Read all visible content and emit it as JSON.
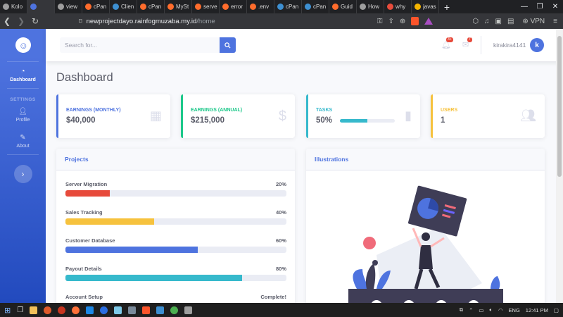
{
  "browser": {
    "tabs": [
      {
        "label": "Kolo",
        "color": "#9e9e9e"
      },
      {
        "label": "",
        "color": "#4e73df",
        "active": true
      },
      {
        "label": "view",
        "color": "#9e9e9e"
      },
      {
        "label": "cPan",
        "color": "#ff6c2c"
      },
      {
        "label": "Clien",
        "color": "#3d8fd1"
      },
      {
        "label": "cPan",
        "color": "#ff6c2c"
      },
      {
        "label": "MySt",
        "color": "#ff6c2c"
      },
      {
        "label": "serve",
        "color": "#ff6c2c"
      },
      {
        "label": "error",
        "color": "#ff6c2c"
      },
      {
        "label": ".env",
        "color": "#ff6c2c"
      },
      {
        "label": "cPan",
        "color": "#3d8fd1"
      },
      {
        "label": "cPan",
        "color": "#3d8fd1"
      },
      {
        "label": "Guid",
        "color": "#ff6c2c"
      },
      {
        "label": "How",
        "color": "#9e9e9e"
      },
      {
        "label": "why",
        "color": "#e74c3c"
      },
      {
        "label": "javas",
        "color": "#f4b400"
      }
    ],
    "url_host": "newprojectdayo.rainfogmuzaba.my.id",
    "url_path": "/home",
    "vpn_label": "VPN"
  },
  "sidebar": {
    "dashboard_label": "Dashboard",
    "heading": "SETTINGS",
    "profile_label": "Profile",
    "about_label": "About"
  },
  "topbar": {
    "search_placeholder": "Search for...",
    "alerts_badge": "3+",
    "messages_badge": "7",
    "username": "kirakira4141",
    "avatar_letter": "k"
  },
  "page_title": "Dashboard",
  "stats": [
    {
      "label": "EARNINGS (MONTHLY)",
      "value": "$40,000",
      "color": "#4e73df",
      "icon": "calendar-icon"
    },
    {
      "label": "EARNINGS (ANNUAL)",
      "value": "$215,000",
      "color": "#1cc88a",
      "icon": "dollar-icon"
    },
    {
      "label": "TASKS",
      "value": "50%",
      "progress": 50,
      "color": "#36b9cc",
      "icon": "clipboard-icon"
    },
    {
      "label": "USERS",
      "value": "1",
      "color": "#f6c23e",
      "icon": "users-icon"
    }
  ],
  "projects": {
    "title": "Projects",
    "items": [
      {
        "name": "Server Migration",
        "value_text": "20%",
        "percent": 20,
        "color": "#e74a3b"
      },
      {
        "name": "Sales Tracking",
        "value_text": "40%",
        "percent": 40,
        "color": "#f6c23e"
      },
      {
        "name": "Customer Database",
        "value_text": "60%",
        "percent": 60,
        "color": "#4e73df"
      },
      {
        "name": "Payout Details",
        "value_text": "80%",
        "percent": 80,
        "color": "#36b9cc"
      },
      {
        "name": "Account Setup",
        "value_text": "Complete!",
        "percent": 100,
        "color": "#1cc88a"
      }
    ]
  },
  "illustrations": {
    "title": "Illustrations"
  },
  "taskbar": {
    "language": "ENG",
    "time": "12:41 PM"
  }
}
